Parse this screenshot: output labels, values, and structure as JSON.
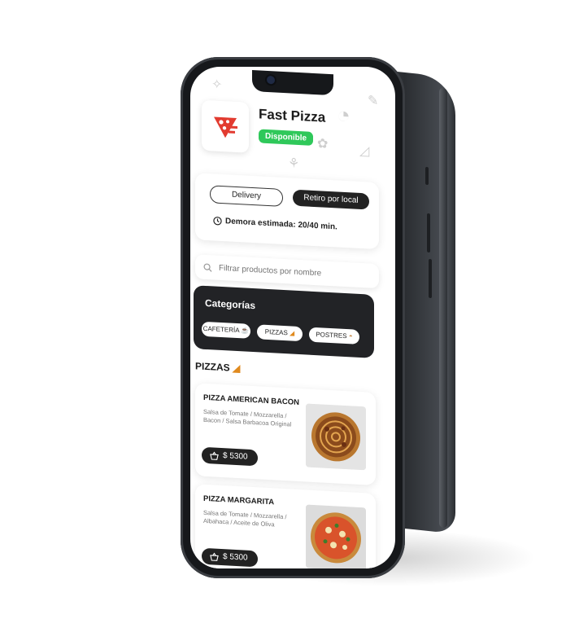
{
  "shop": {
    "name": "Fast Pizza",
    "status": "Disponible",
    "logo_text": "F"
  },
  "delivery": {
    "delivery_label": "Delivery",
    "pickup_label": "Retiro por local",
    "eta": "Demora estimada: 20/40 min."
  },
  "search": {
    "placeholder": "Filtrar productos por nombre"
  },
  "categories": {
    "title": "Categorías",
    "items": [
      {
        "label": "CAFETERÍA",
        "icon": "coffee-icon"
      },
      {
        "label": "PIZZAS",
        "icon": "pizza-icon"
      },
      {
        "label": "POSTRES",
        "icon": "dessert-icon"
      }
    ]
  },
  "section": {
    "title": "PIZZAS",
    "icon": "pizza-icon"
  },
  "products": [
    {
      "name": "PIZZA AMERICAN BACON",
      "description": "Salsa de Tomate / Mozzarella / Bacon / Salsa Barbacoa Original",
      "price": "$ 5300"
    },
    {
      "name": "PIZZA MARGARITA",
      "description": "Salsa de Tomate / Mozzarella / Albahaca / Aceite de Oliva",
      "price": "$ 5300"
    }
  ],
  "colors": {
    "accent_dark": "#222326",
    "status_green": "#2fc85a",
    "logo_red": "#e23b30"
  }
}
